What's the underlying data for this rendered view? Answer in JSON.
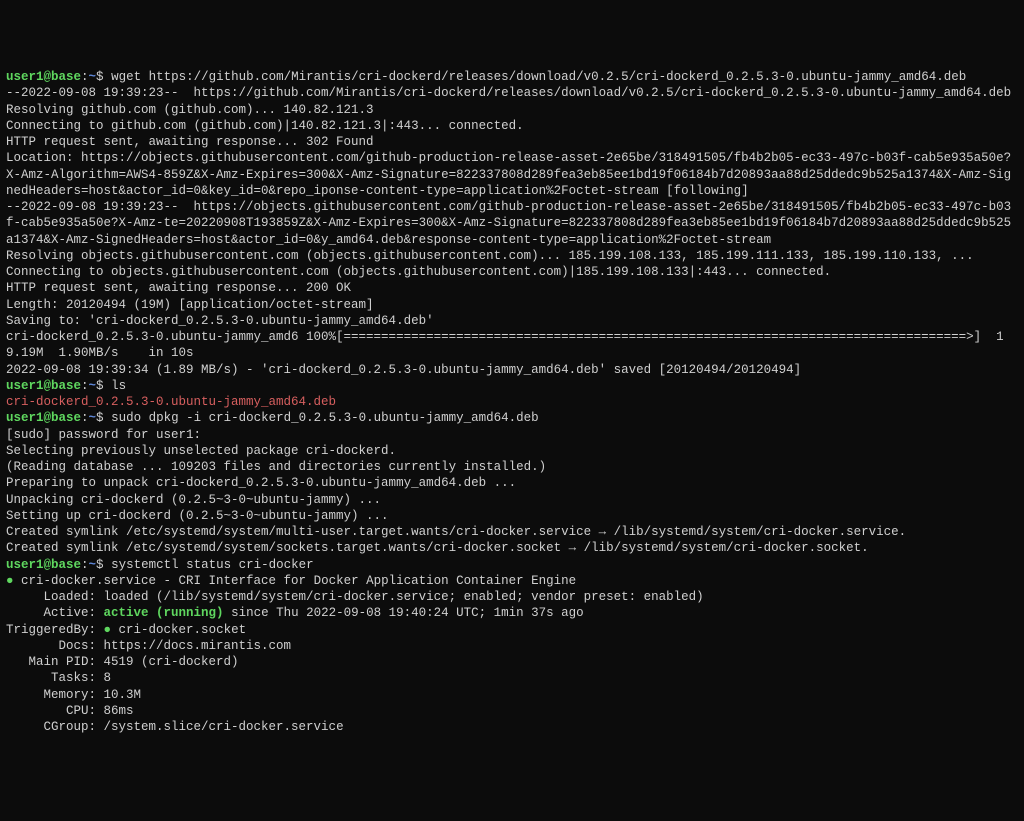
{
  "prompt1": {
    "user": "user1@base",
    "path": "~",
    "symbol": "$",
    "command": "wget https://github.com/Mirantis/cri-dockerd/releases/download/v0.2.5/cri-dockerd_0.2.5.3-0.ubuntu-jammy_amd64.deb"
  },
  "wget_output": {
    "l1": "--2022-09-08 19:39:23--  https://github.com/Mirantis/cri-dockerd/releases/download/v0.2.5/cri-dockerd_0.2.5.3-0.ubuntu-jammy_amd64.deb",
    "l2": "Resolving github.com (github.com)... 140.82.121.3",
    "l3": "Connecting to github.com (github.com)|140.82.121.3|:443... connected.",
    "l4": "HTTP request sent, awaiting response... 302 Found",
    "l5": "Location: https://objects.githubusercontent.com/github-production-release-asset-2e65be/318491505/fb4b2b05-ec33-497c-b03f-cab5e935a50e?X-Amz-Algorithm=AWS4-859Z&X-Amz-Expires=300&X-Amz-Signature=822337808d289fea3eb85ee1bd19f06184b7d20893aa88d25ddedc9b525a1374&X-Amz-SignedHeaders=host&actor_id=0&key_id=0&repo_iponse-content-type=application%2Foctet-stream [following]",
    "l6": "--2022-09-08 19:39:23--  https://objects.githubusercontent.com/github-production-release-asset-2e65be/318491505/fb4b2b05-ec33-497c-b03f-cab5e935a50e?X-Amz-te=20220908T193859Z&X-Amz-Expires=300&X-Amz-Signature=822337808d289fea3eb85ee1bd19f06184b7d20893aa88d25ddedc9b525a1374&X-Amz-SignedHeaders=host&actor_id=0&y_amd64.deb&response-content-type=application%2Foctet-stream",
    "l7": "Resolving objects.githubusercontent.com (objects.githubusercontent.com)... 185.199.108.133, 185.199.111.133, 185.199.110.133, ...",
    "l8": "Connecting to objects.githubusercontent.com (objects.githubusercontent.com)|185.199.108.133|:443... connected.",
    "l9": "HTTP request sent, awaiting response... 200 OK",
    "l10": "Length: 20120494 (19M) [application/octet-stream]",
    "l11": "Saving to: 'cri-dockerd_0.2.5.3-0.ubuntu-jammy_amd64.deb'",
    "l12": "",
    "l13": "cri-dockerd_0.2.5.3-0.ubuntu-jammy_amd6 100%[===================================================================================>]  19.19M  1.90MB/s    in 10s",
    "l14": "",
    "l15": "2022-09-08 19:39:34 (1.89 MB/s) - 'cri-dockerd_0.2.5.3-0.ubuntu-jammy_amd64.deb' saved [20120494/20120494]",
    "l16": ""
  },
  "prompt2": {
    "user": "user1@base",
    "path": "~",
    "symbol": "$",
    "command": "ls"
  },
  "ls_output": "cri-dockerd_0.2.5.3-0.ubuntu-jammy_amd64.deb",
  "prompt3": {
    "user": "user1@base",
    "path": "~",
    "symbol": "$",
    "command": "sudo dpkg -i cri-dockerd_0.2.5.3-0.ubuntu-jammy_amd64.deb"
  },
  "dpkg_output": {
    "l1": "[sudo] password for user1:",
    "l2": "Selecting previously unselected package cri-dockerd.",
    "l3": "(Reading database ... 109203 files and directories currently installed.)",
    "l4": "Preparing to unpack cri-dockerd_0.2.5.3-0.ubuntu-jammy_amd64.deb ...",
    "l5": "Unpacking cri-dockerd (0.2.5~3-0~ubuntu-jammy) ...",
    "l6": "Setting up cri-dockerd (0.2.5~3-0~ubuntu-jammy) ...",
    "l7": "Created symlink /etc/systemd/system/multi-user.target.wants/cri-docker.service → /lib/systemd/system/cri-docker.service.",
    "l8": "Created symlink /etc/systemd/system/sockets.target.wants/cri-docker.socket → /lib/systemd/system/cri-docker.socket."
  },
  "prompt4": {
    "user": "user1@base",
    "path": "~",
    "symbol": "$",
    "command": "systemctl status cri-docker"
  },
  "systemctl_output": {
    "dot": "●",
    "l1_service": " cri-docker.service - CRI Interface for Docker Application Container Engine",
    "l2": "     Loaded: loaded (/lib/systemd/system/cri-docker.service; enabled; vendor preset: enabled)",
    "l3_pre": "     Active: ",
    "l3_active": "active (running)",
    "l3_post": " since Thu 2022-09-08 19:40:24 UTC; 1min 37s ago",
    "l4_pre": "TriggeredBy: ",
    "l4_dot": "●",
    "l4_post": " cri-docker.socket",
    "l5": "       Docs: https://docs.mirantis.com",
    "l6": "   Main PID: 4519 (cri-dockerd)",
    "l7": "      Tasks: 8",
    "l8": "     Memory: 10.3M",
    "l9": "        CPU: 86ms",
    "l10": "     CGroup: /system.slice/cri-docker.service"
  }
}
